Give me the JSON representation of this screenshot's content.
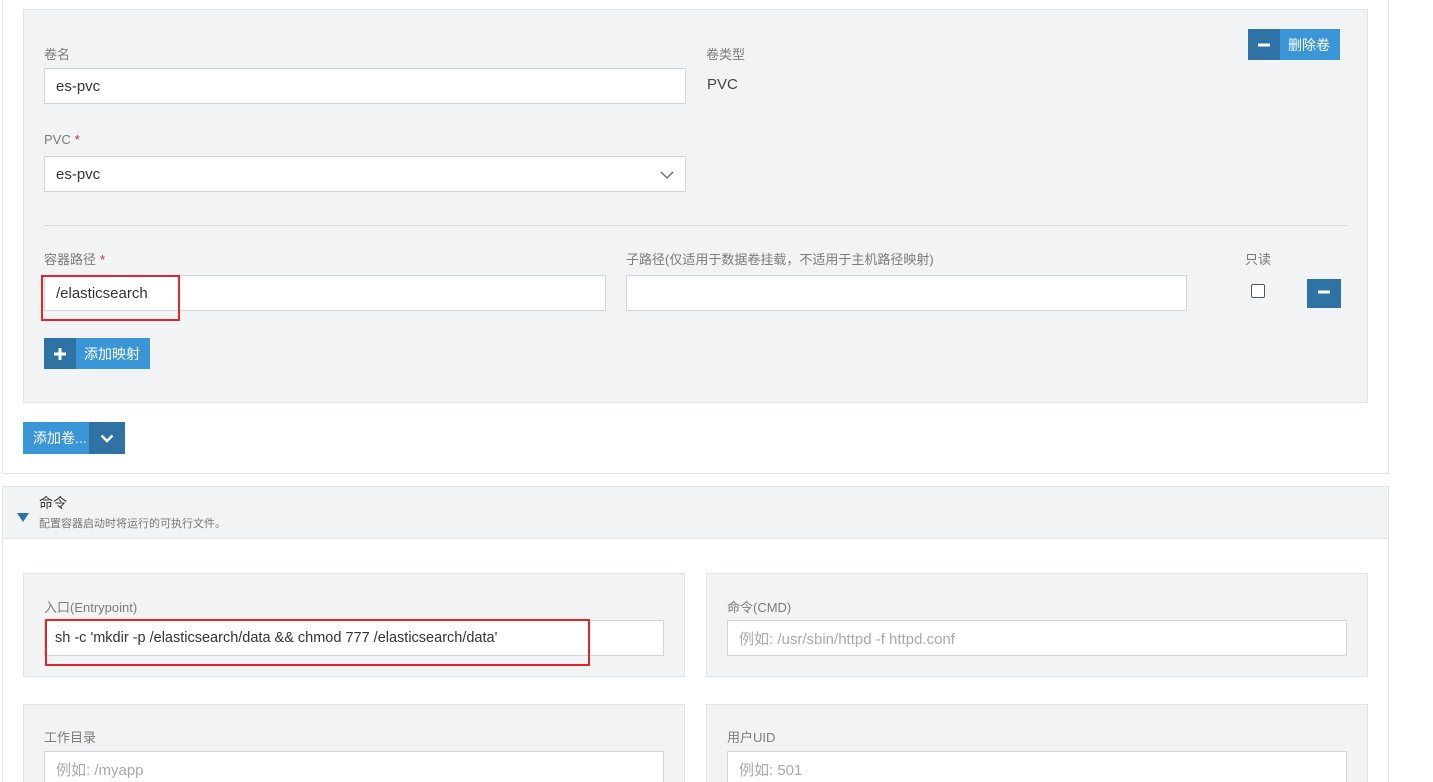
{
  "volume": {
    "name_label": "卷名",
    "name_value": "es-pvc",
    "type_label": "卷类型",
    "type_value": "PVC",
    "delete_label": "删除卷",
    "pvc_label": "PVC",
    "required_mark": "*",
    "pvc_value": "es-pvc",
    "mount": {
      "container_path_label": "容器路径",
      "container_path_value": "/elasticsearch",
      "subpath_label": "子路径(仅适用于数据卷挂载，不适用于主机路径映射)",
      "subpath_value": "",
      "readonly_label": "只读"
    },
    "add_mapping_label": "添加映射"
  },
  "add_volume_label": "添加卷...",
  "command_section": {
    "title": "命令",
    "subtitle": "配置容器启动时将运行的可执行文件。",
    "entrypoint_label": "入口(Entrypoint)",
    "entrypoint_value": "sh -c 'mkdir -p /elasticsearch/data && chmod 777 /elasticsearch/data'",
    "cmd_label": "命令(CMD)",
    "cmd_placeholder": "例如: /usr/sbin/httpd -f httpd.conf",
    "workdir_label": "工作目录",
    "workdir_placeholder": "例如: /myapp",
    "uid_label": "用户UID",
    "uid_placeholder": "例如: 501"
  }
}
